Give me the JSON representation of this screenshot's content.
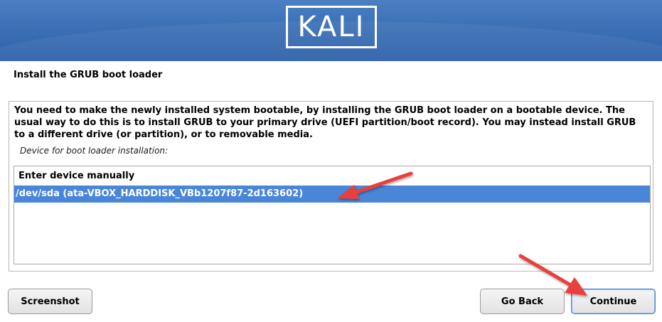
{
  "banner": {
    "logo_text": "KALI",
    "background_color": "#3a6fb5"
  },
  "dialog": {
    "title": "Install the GRUB boot loader",
    "description": "You need to make the newly installed system bootable, by installing the GRUB boot loader on a bootable device. The usual way to do this is to install GRUB to your primary drive (UEFI partition/boot record). You may instead install GRUB to a different drive (or partition), or to removable media.",
    "question": "Device for boot loader installation:",
    "options": [
      {
        "label": "Enter device manually",
        "selected": false
      },
      {
        "label": "/dev/sda  (ata-VBOX_HARDDISK_VBb1207f87-2d163602)",
        "selected": true
      }
    ],
    "selection_color": "#4a86d8"
  },
  "buttons": {
    "screenshot": "Screenshot",
    "go_back": "Go Back",
    "continue": "Continue"
  },
  "annotations": {
    "arrow_color": "#e8413c"
  }
}
